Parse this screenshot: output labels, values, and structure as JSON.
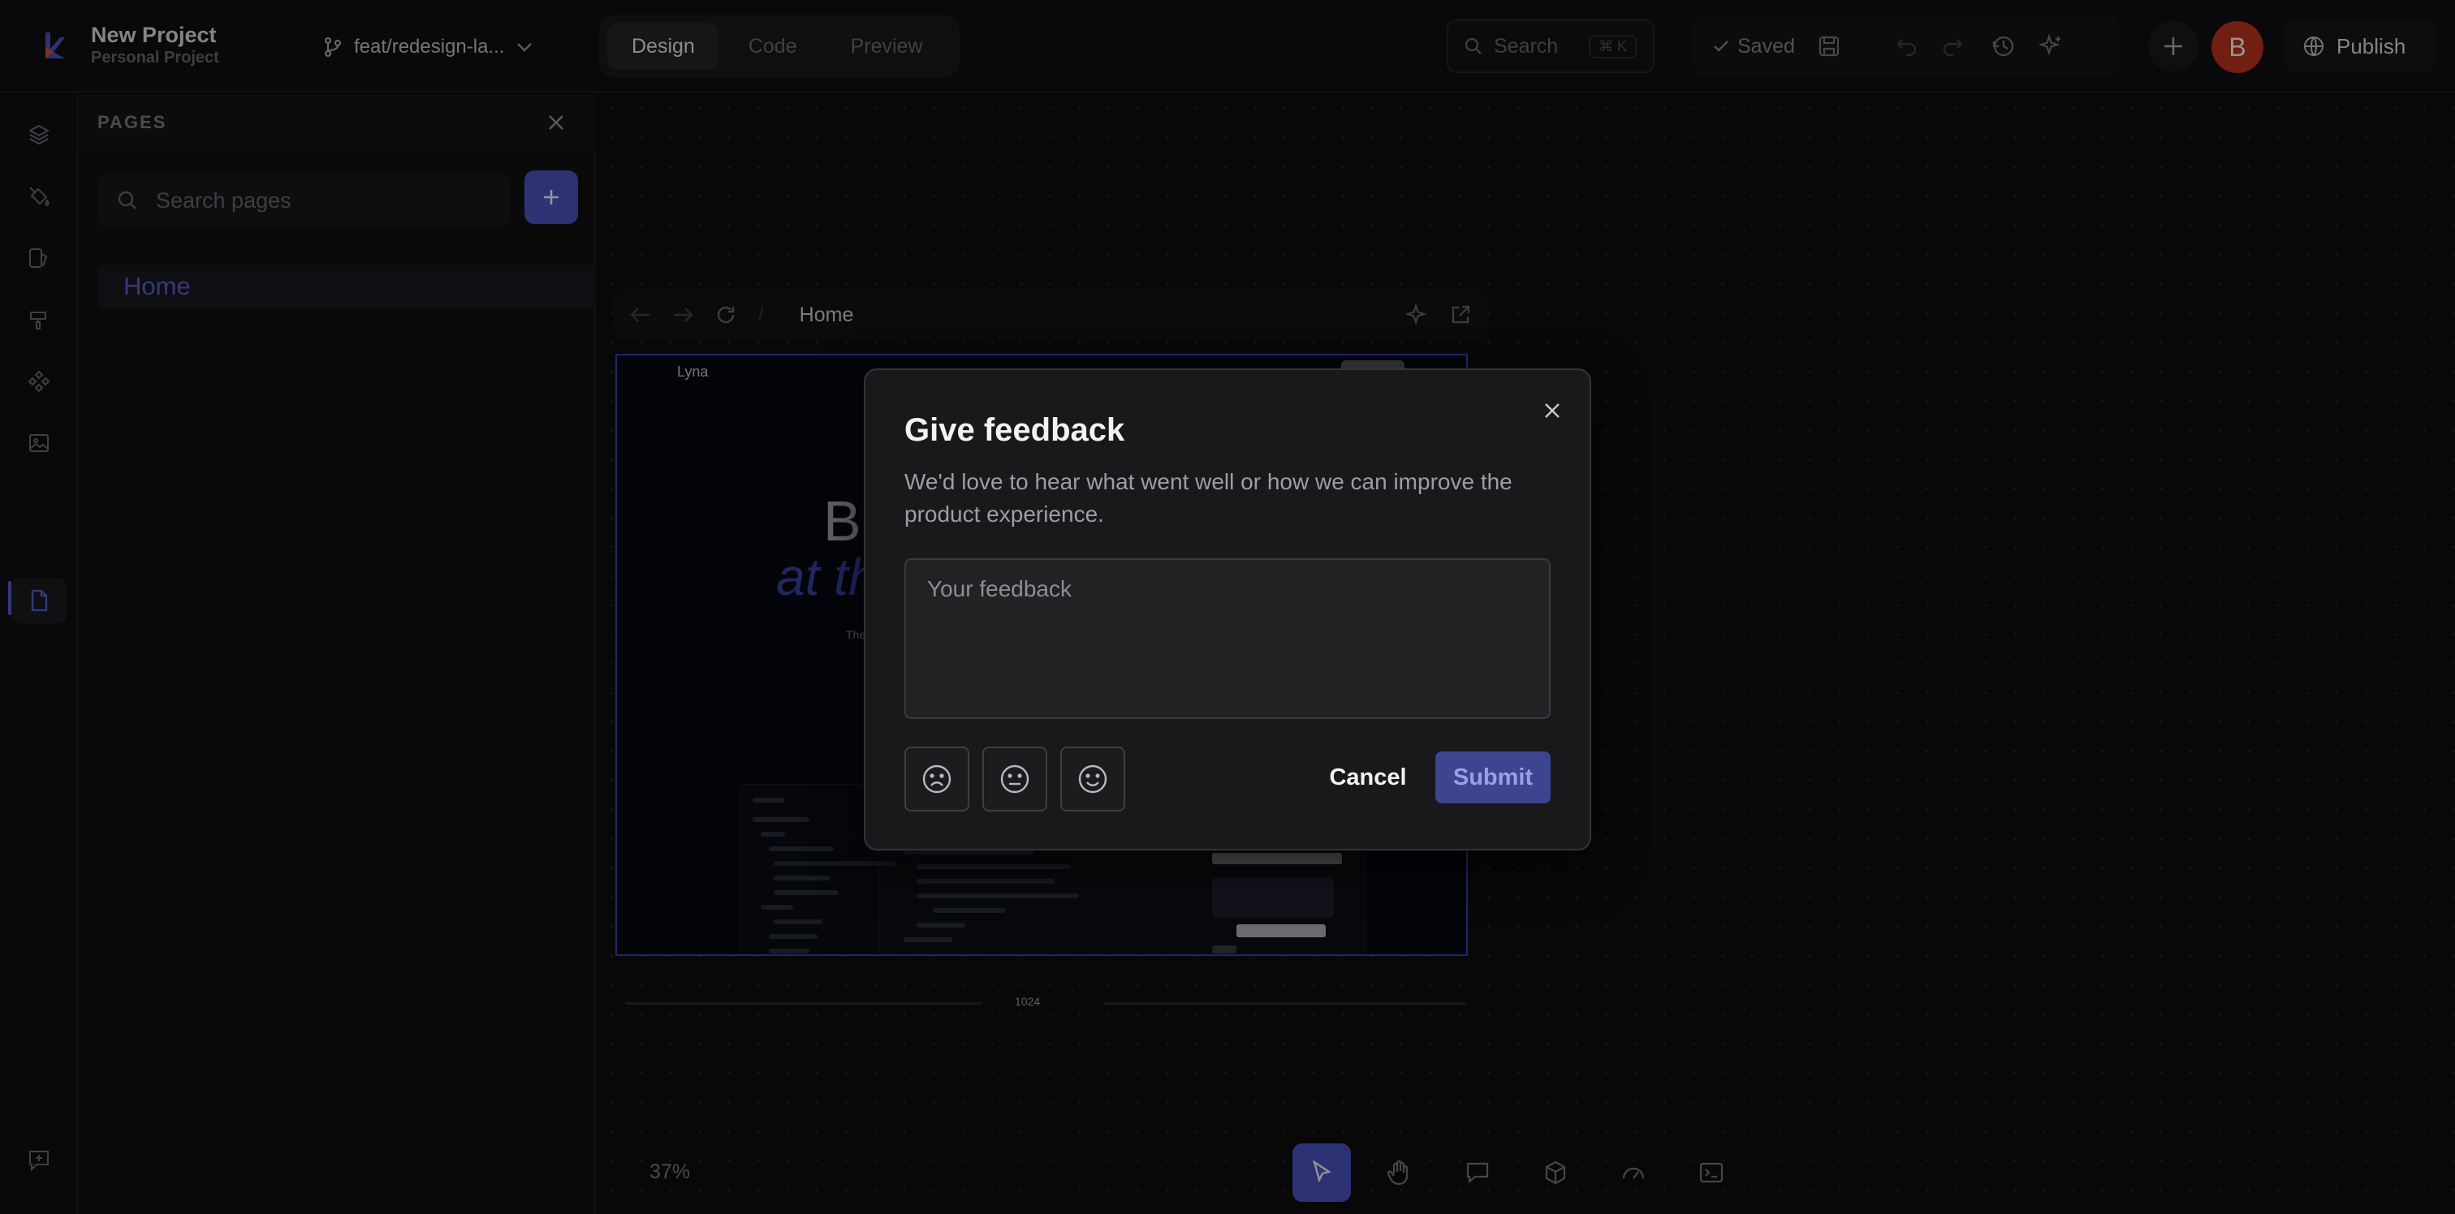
{
  "topbar": {
    "project_name": "New Project",
    "project_sub": "Personal Project",
    "branch": "feat/redesign-la...",
    "tabs": [
      {
        "label": "Design",
        "active": true
      },
      {
        "label": "Code",
        "active": false
      },
      {
        "label": "Preview",
        "active": false
      }
    ],
    "search_label": "Search",
    "search_shortcut": "⌘ K",
    "saved_label": "Saved",
    "avatar_initial": "B",
    "publish_label": "Publish"
  },
  "panel": {
    "title": "PAGES",
    "search_placeholder": "Search pages",
    "pages": [
      {
        "label": "Home",
        "active": true
      }
    ]
  },
  "canvas": {
    "breadcrumb": "Home",
    "preview_brand": "Lyna",
    "hero_line1": "Bu",
    "hero_line2": "at th",
    "hero_line3": "The",
    "viewport_width": "1024",
    "zoom": "37%"
  },
  "modal": {
    "title": "Give feedback",
    "description": "We'd love to hear what went well or how we can improve the product experience.",
    "placeholder": "Your feedback",
    "moods": [
      "sad-face-icon",
      "neutral-face-icon",
      "happy-face-icon"
    ],
    "cancel_label": "Cancel",
    "submit_label": "Submit"
  },
  "colors": {
    "accent": "#4e56c8",
    "avatar": "#c2361f",
    "background": "#0e0e10"
  }
}
